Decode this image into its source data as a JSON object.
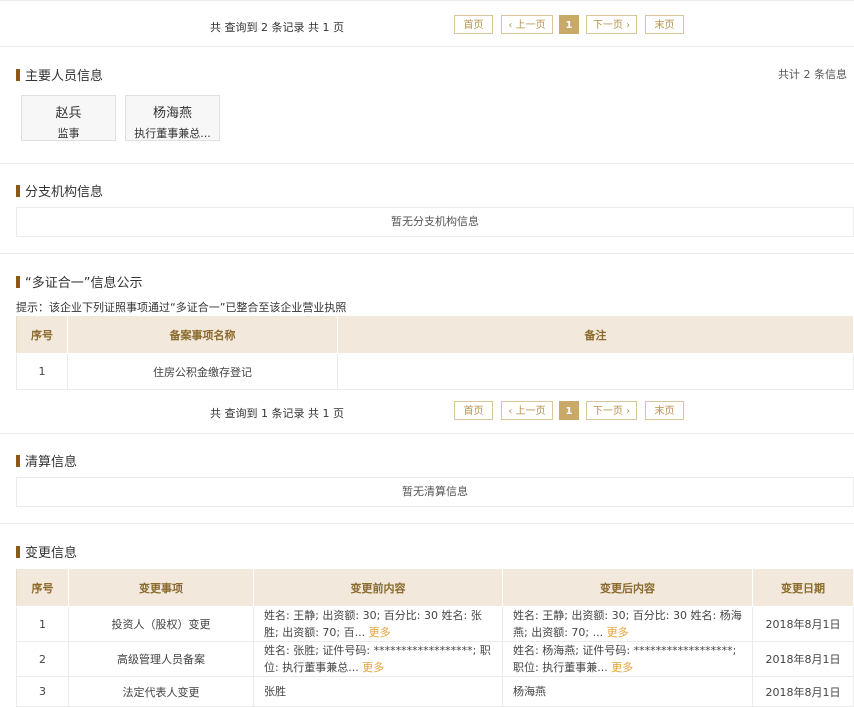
{
  "pager1": {
    "summary": "共 查询到 2 条记录 共 1 页",
    "first": "首页",
    "prev": "上一页",
    "current": "1",
    "next": "下一页",
    "last": "末页"
  },
  "personnel": {
    "title": "主要人员信息",
    "count": "共计 2 条信息",
    "people": [
      {
        "name": "赵兵",
        "role": "监事"
      },
      {
        "name": "杨海燕",
        "role": "执行董事兼总..."
      }
    ]
  },
  "branch": {
    "title": "分支机构信息",
    "empty": "暂无分支机构信息"
  },
  "multi_cert": {
    "title": "“多证合一”信息公示",
    "hint": "提示：该企业下列证照事项通过“多证合一”已整合至该企业营业执照",
    "headers": [
      "序号",
      "备案事项名称",
      "备注"
    ],
    "rows": [
      [
        "1",
        "住房公积金缴存登记",
        ""
      ]
    ]
  },
  "pager2": {
    "summary": "共 查询到 1 条记录 共 1 页",
    "first": "首页",
    "prev": "上一页",
    "current": "1",
    "next": "下一页",
    "last": "末页"
  },
  "liquidation": {
    "title": "清算信息",
    "empty": "暂无清算信息"
  },
  "changes": {
    "title": "变更信息",
    "headers": [
      "序号",
      "变更事项",
      "变更前内容",
      "变更后内容",
      "变更日期"
    ],
    "more": "更多",
    "rows": [
      {
        "no": "1",
        "item": "投资人（股权）变更",
        "before": "姓名: 王静; 出资额: 30; 百分比: 30 姓名: 张胜; 出资额: 70; 百...",
        "after": "姓名: 王静; 出资额: 30; 百分比: 30 姓名: 杨海燕; 出资额: 70; ...",
        "date": "2018年8月1日"
      },
      {
        "no": "2",
        "item": "高级管理人员备案",
        "before": "姓名: 张胜; 证件号码: ******************; 职位: 执行董事兼总...",
        "after": "姓名: 杨海燕; 证件号码: ******************; 职位: 执行董事兼...",
        "date": "2018年8月1日"
      },
      {
        "no": "3",
        "item": "法定代表人变更",
        "before": "张胜",
        "after": "杨海燕",
        "date": "2018年8月1日"
      }
    ]
  }
}
